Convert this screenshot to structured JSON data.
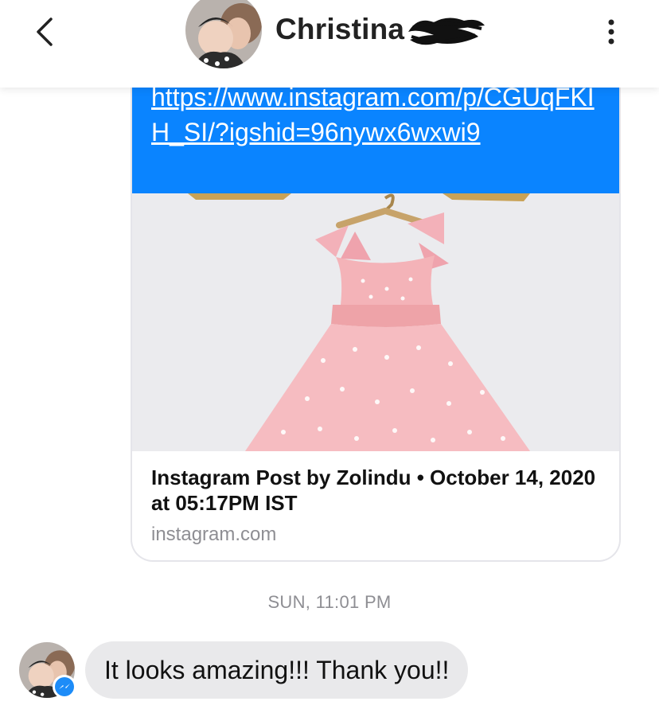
{
  "header": {
    "contact_name": "Christina",
    "back_icon": "chevron-left-icon",
    "more_icon": "more-vertical-icon"
  },
  "link_message": {
    "url": "https://www.instagram.com/p/CGUqFKIH_SI/?igshid=96nywx6wxwi9",
    "preview_title": "Instagram Post by Zolindu • October 14, 2020 at 05:17PM IST",
    "preview_domain": "instagram.com"
  },
  "timestamp": "SUN, 11:01 PM",
  "incoming_message": {
    "text": "It looks amazing!!! Thank you!!"
  },
  "colors": {
    "link_bubble": "#0a84ff",
    "incoming_bubble": "#e9e9eb",
    "timestamp": "#8e8e93"
  }
}
